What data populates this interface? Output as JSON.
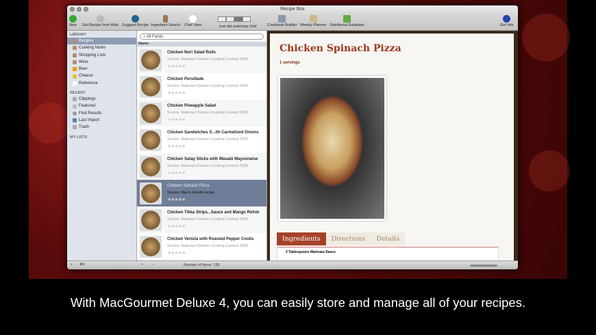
{
  "window": {
    "title": "Recipe Box"
  },
  "toolbar": {
    "new": "New",
    "get_web": "Get Recipe from Web",
    "suggest": "Suggest Recipe",
    "ingredient_search": "Ingredient Search",
    "chef_view": "Chef View",
    "view_modes": "icon   list  summary chef",
    "cookbook": "Cookbook Builder",
    "planner": "Weekly Planner",
    "nutrition": "Nutritional Database",
    "info": "Get Info"
  },
  "sidebar": {
    "library_header": "LIBRARY",
    "library": [
      {
        "label": "Recipes"
      },
      {
        "label": "Cooking Notes"
      },
      {
        "label": "Shopping Lists"
      },
      {
        "label": "Wine"
      },
      {
        "label": "Beer"
      },
      {
        "label": "Cheese"
      },
      {
        "label": "Reference"
      }
    ],
    "recent_header": "RECENT",
    "recent": [
      {
        "label": "Clippings"
      },
      {
        "label": "Featured"
      },
      {
        "label": "Find Results"
      },
      {
        "label": "Last Import"
      },
      {
        "label": "Trash"
      }
    ],
    "mylists_header": "MY LISTS"
  },
  "list": {
    "search_placeholder": "All Fields",
    "column": "Name",
    "rows": [
      {
        "title": "Chicken Nori Salad Rolls",
        "source": "Source: National Chicken Cooking Contest 2003"
      },
      {
        "title": "Chicken Persillade",
        "source": "Source: National Chicken Cooking Contest 2005"
      },
      {
        "title": "Chicken Pineapple Salad",
        "source": "Source: National Chicken Cooking Contest 2005"
      },
      {
        "title": "Chicken Sandwiches S...ith Carmelized Onions",
        "source": "Source: National Chicken Cooking Contest 2003"
      },
      {
        "title": "Chicken Satay Sticks with Wasabi Mayonnaise",
        "source": "Source: National Chicken Cooking Contest 2005"
      },
      {
        "title": "Chicken Spinach Pizza",
        "source": "Source: Men's Health recipe"
      },
      {
        "title": "Chicken Tikka Strips...Sauce and Mango Relish",
        "source": "Source: National Chicken Cooking Contest 2003"
      },
      {
        "title": "Chicken Venizia with Roasted Pepper Coulis",
        "source": "Source: National Chicken Cooking Contest 2005"
      }
    ],
    "selected_index": 5,
    "rating_stars": "★★★★★"
  },
  "detail": {
    "title": "Chicken Spinach Pizza",
    "servings": "1 servings",
    "tabs": [
      "Ingredients",
      "Directions",
      "Details"
    ],
    "ingredient": "3 Tablespoons Marinara Sauce"
  },
  "bottom": {
    "count": "Number of items: 195"
  },
  "caption": "With MacGourmet Deluxe 4, you can easily store and manage all of your recipes.",
  "colors": {
    "accent": "#a5432a",
    "selection": "#6f7e98"
  }
}
